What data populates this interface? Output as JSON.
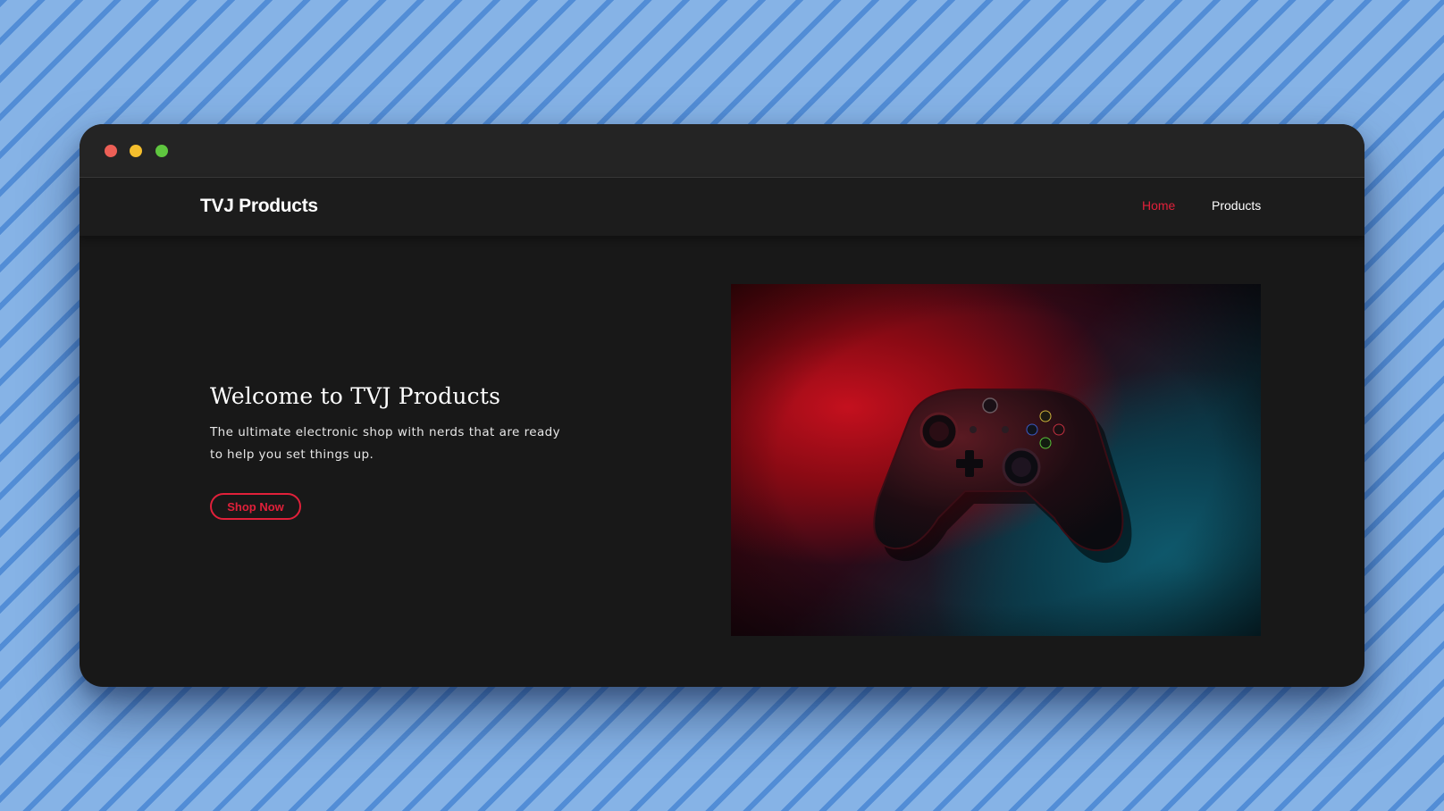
{
  "window": {
    "controls": [
      "close-icon",
      "minimize-icon",
      "maximize-icon"
    ]
  },
  "navbar": {
    "brand": "TVJ Products",
    "links": [
      {
        "label": "Home",
        "active": true
      },
      {
        "label": "Products",
        "active": false
      }
    ]
  },
  "hero": {
    "title": "Welcome to TVJ Products",
    "text": "The ultimate electronic shop with nerds that are ready to help you set things up.",
    "button": "Shop Now",
    "image": "game-controller-image"
  },
  "colors": {
    "accent": "#e0203a",
    "background": "#181818",
    "navbar": "#1c1c1c",
    "titlebar": "#242424",
    "desktop": "#86b3e6"
  }
}
